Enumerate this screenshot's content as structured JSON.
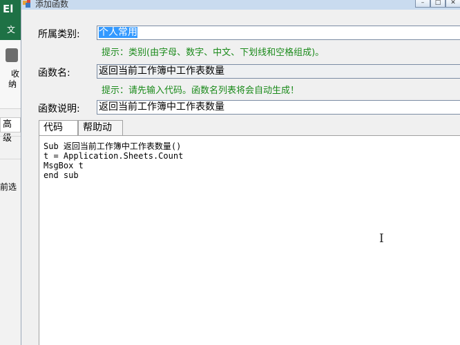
{
  "background_app": {
    "app_letter": "El",
    "file_tab": "文",
    "ribbon_label_1": "收",
    "ribbon_label_2": "纳",
    "advanced_tab": "高级",
    "cut_text": "前选",
    "ribbon_color": "#1e7145"
  },
  "window": {
    "title": "添加函数",
    "minimize": "–",
    "maximize": "□",
    "close": "✕"
  },
  "form": {
    "category_label": "所属类别:",
    "category_value": "个人常用",
    "category_hint": "提示：类别(由字母、数字、中文、下划线和空格组成)。",
    "name_label": "函数名:",
    "name_value": "返回当前工作簿中工作表数量",
    "name_hint": "提示：请先输入代码。函数名列表将会自动生成！",
    "desc_label": "函数说明:",
    "desc_value": "返回当前工作簿中工作表数量"
  },
  "tabs": [
    {
      "label": "代码",
      "active": true
    },
    {
      "label": "帮助动画",
      "active": false
    }
  ],
  "code": {
    "lines": [
      "Sub 返回当前工作簿中工作表数量()",
      "t = Application.Sheets.Count",
      "MsgBox t",
      "end sub"
    ]
  },
  "colors": {
    "hint_green": "#1a8a1a",
    "selection_blue": "#3399ff"
  }
}
